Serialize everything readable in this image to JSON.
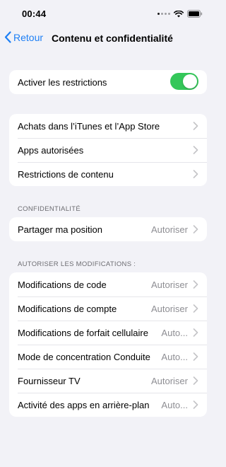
{
  "status_bar": {
    "time": "00:44"
  },
  "nav": {
    "back_label": "Retour",
    "title": "Contenu et confidentialité"
  },
  "restrictions": {
    "label": "Activer les restrictions",
    "enabled": true
  },
  "group_store": {
    "items": [
      {
        "label": "Achats dans l’iTunes et l’App Store"
      },
      {
        "label": "Apps autorisées"
      },
      {
        "label": "Restrictions de contenu"
      }
    ]
  },
  "privacy": {
    "header": "CONFIDENTIALITÉ",
    "items": [
      {
        "label": "Partager ma position",
        "value": "Autoriser"
      }
    ]
  },
  "changes": {
    "header": "AUTORISER LES MODIFICATIONS :",
    "items": [
      {
        "label": "Modifications de code",
        "value": "Autoriser"
      },
      {
        "label": "Modifications de compte",
        "value": "Autoriser"
      },
      {
        "label": "Modifications de forfait cellulaire",
        "value": "Auto..."
      },
      {
        "label": "Mode de concentration Conduite",
        "value": "Auto..."
      },
      {
        "label": "Fournisseur TV",
        "value": "Autoriser"
      },
      {
        "label": "Activité des apps en arrière-plan",
        "value": "Auto..."
      }
    ]
  },
  "colors": {
    "accent": "#1d7ff5",
    "toggle_on": "#34c759",
    "background": "#f2f2f7",
    "secondary_text": "#8e8e93"
  }
}
